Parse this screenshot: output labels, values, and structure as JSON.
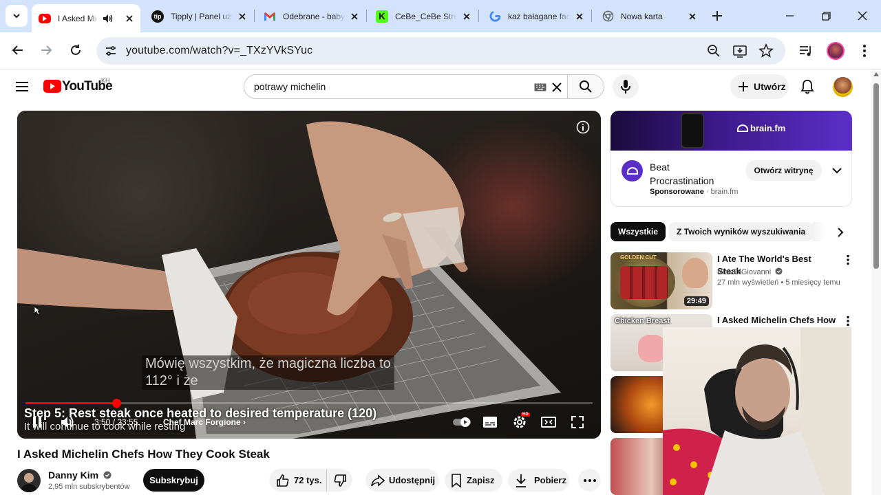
{
  "browser": {
    "tabs": [
      {
        "title": "I Asked Michelin Chefs How They Cook Steak",
        "favicon": "youtube-icon",
        "active": true,
        "audio": true
      },
      {
        "title": "Tipply | Panel użytkownika",
        "favicon": "tipply-icon",
        "active": false
      },
      {
        "title": "Odebrane - babyc",
        "favicon": "gmail-icon",
        "active": false
      },
      {
        "title": "CeBe_CeBe Stream",
        "favicon": "kick-icon",
        "active": false
      },
      {
        "title": "kaz bałagane face",
        "favicon": "google-icon",
        "active": false
      },
      {
        "title": "Nowa karta",
        "favicon": "chrome-icon",
        "active": false
      }
    ],
    "url": "youtube.com/watch?v=_TXzYVkSYuc"
  },
  "masthead": {
    "logo_text": "YouTube",
    "country_code": "KH",
    "search_query": "potrawy michelin",
    "create_label": "Utwórz"
  },
  "player": {
    "caption_line1": "Mówię wszystkim, że magiczna liczba to",
    "caption_line2": "112° i że",
    "chapter_title": "Step 5: Rest steak once heated to desired temperature (120)",
    "chapter_subtitle": "It will continue to cook while resting",
    "time": "3:50 / 23:55",
    "chapter_link": "Chef Marc Forgione",
    "progress_fraction": 0.16
  },
  "video": {
    "title": "I Asked Michelin Chefs How They Cook Steak",
    "channel": "Danny Kim",
    "subscribers": "2,95 mln subskrybentów",
    "subscribe_label": "Subskrybuj",
    "likes": "72 tys.",
    "share_label": "Udostępnij",
    "save_label": "Zapisz",
    "download_label": "Pobierz"
  },
  "ad": {
    "banner_brand": "brain.fm",
    "title": "Beat Procrastination",
    "sponsored_label": "Sponsorowane",
    "domain": "brain.fm",
    "open_label": "Otwórz witrynę"
  },
  "chips": [
    "Wszystkie",
    "Z Twoich wyników wyszukiwania"
  ],
  "recommendations": [
    {
      "title": "I Ate The World's Best Steak",
      "channel": "Nick DiGiovanni",
      "stats": "27 mln wyświetleń • 5 miesięcy temu",
      "duration": "29:49",
      "thumb_text": "GOLDEN CUT"
    },
    {
      "title": "I Asked Michelin Chefs How",
      "channel": "",
      "stats": "",
      "duration": "",
      "thumb_text": "Chicken Breast"
    }
  ],
  "colors": {
    "yt_red": "#ff0000",
    "tabbar_bg": "#d3e3fd",
    "ad_purple": "#5b2fc7"
  }
}
